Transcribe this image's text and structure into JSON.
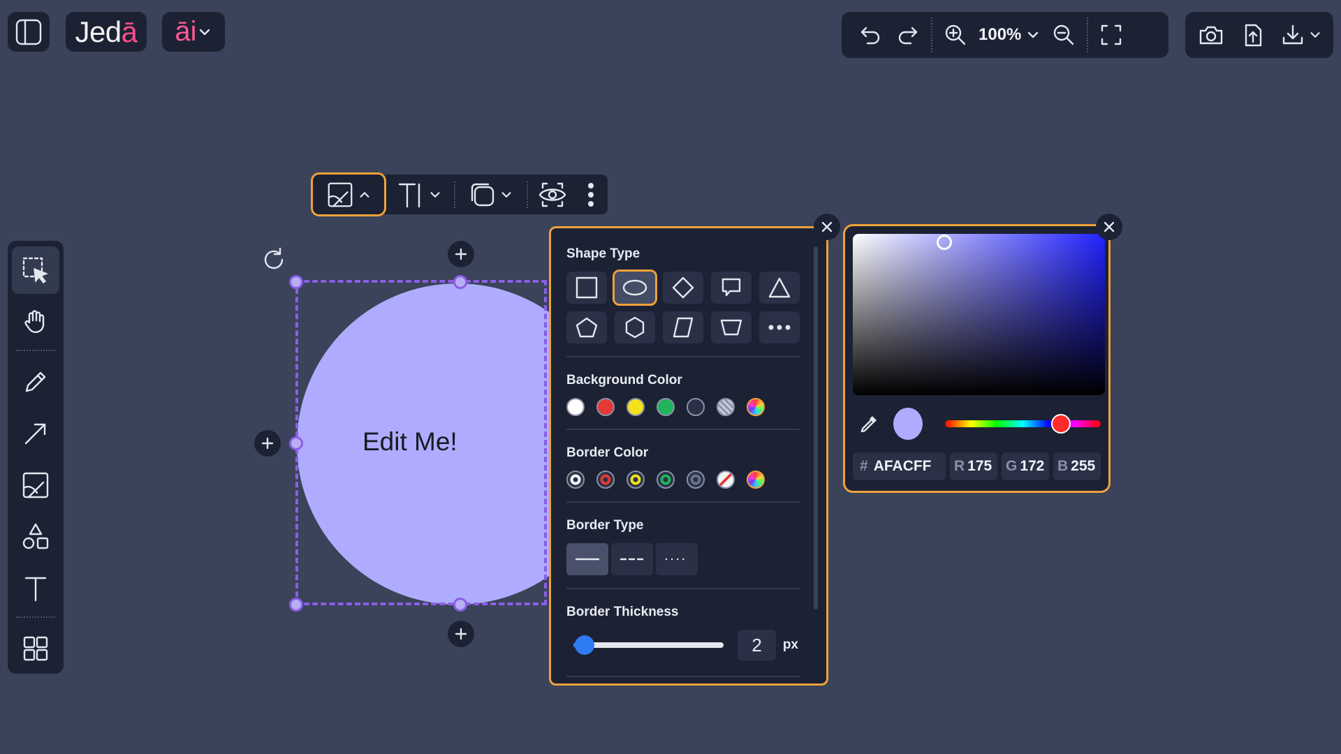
{
  "app": {
    "logo_text": "Jed",
    "logo_accent": "ā",
    "ai_label": "āi",
    "zoom_level": "100%"
  },
  "icons": {
    "top_left": [
      "sidebar-toggle-icon",
      "chevron-down-icon"
    ],
    "top_toolbar": [
      "undo-icon",
      "redo-icon",
      "zoom-in-icon",
      "chevron-down-icon",
      "zoom-out-icon",
      "fullscreen-icon"
    ],
    "io_toolbar": [
      "camera-icon",
      "upload-icon",
      "download-icon",
      "chevron-down-icon"
    ],
    "left_toolbar": [
      "select-icon",
      "hand-icon",
      "pencil-icon",
      "arrow-icon",
      "image-icon",
      "shapes-icon",
      "text-icon",
      "grid-icon"
    ],
    "element_toolbar": [
      "image-icon",
      "chevron-up-icon",
      "text-icon",
      "chevron-down-icon",
      "shape-style-icon",
      "chevron-down-icon",
      "visibility-icon",
      "more-vertical-icon"
    ]
  },
  "canvas": {
    "shape_text": "Edit Me!",
    "shape_fill": "#AFACFF",
    "selection_color": "#8A5EE8"
  },
  "shape_panel": {
    "shape_type_label": "Shape Type",
    "shape_types": [
      "square",
      "ellipse",
      "diamond",
      "speech-bubble",
      "triangle",
      "pentagon",
      "hexagon",
      "parallelogram",
      "trapezoid",
      "more"
    ],
    "selected_shape": "ellipse",
    "background_color_label": "Background Color",
    "background_colors": [
      "#FFFFFF",
      "#E53935",
      "#F2E11C",
      "#21B45A",
      "#2A3146",
      "pattern",
      "multicolor"
    ],
    "border_color_label": "Border Color",
    "border_colors": [
      "#FFFFFF",
      "#E53935",
      "#F2E11C",
      "#21B45A",
      "#6A7290",
      "none",
      "multicolor"
    ],
    "border_type_label": "Border Type",
    "border_types": [
      "solid",
      "dashed",
      "dotted"
    ],
    "selected_border_type": "solid",
    "border_thickness_label": "Border Thickness",
    "border_thickness_value": "2",
    "border_thickness_unit": "px"
  },
  "color_picker": {
    "hex_prefix": "#",
    "hex": "AFACFF",
    "r_label": "R",
    "r": "175",
    "g_label": "G",
    "g": "172",
    "b_label": "B",
    "b": "255",
    "accent_color": "#F0A13A"
  }
}
